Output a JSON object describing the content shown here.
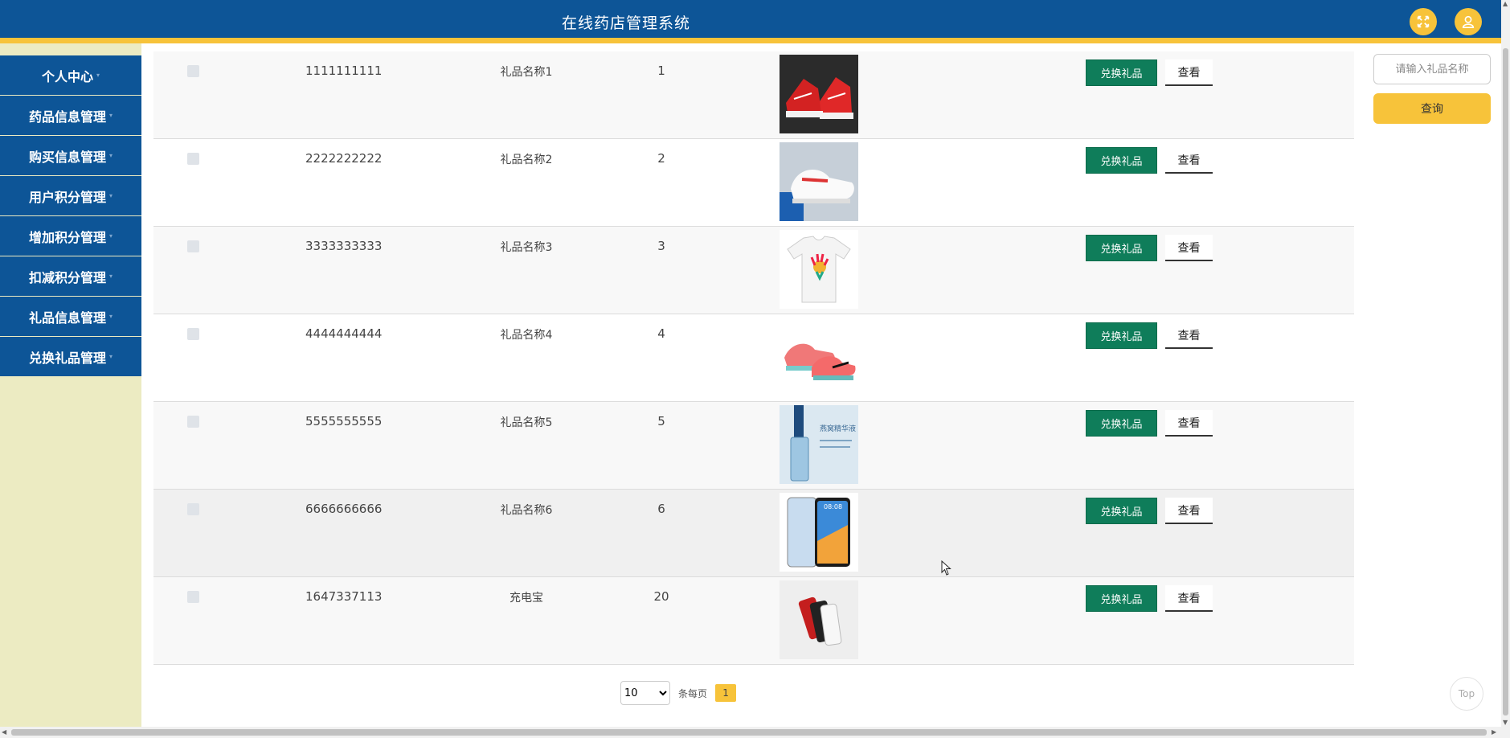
{
  "header": {
    "title": "在线药店管理系统",
    "fullscreen_icon": "expand-icon",
    "user_icon": "user-icon"
  },
  "sidebar": {
    "items": [
      {
        "label": "个人中心"
      },
      {
        "label": "药品信息管理"
      },
      {
        "label": "购买信息管理"
      },
      {
        "label": "用户积分管理"
      },
      {
        "label": "增加积分管理"
      },
      {
        "label": "扣减积分管理"
      },
      {
        "label": "礼品信息管理"
      },
      {
        "label": "兑换礼品管理"
      }
    ]
  },
  "table": {
    "rows": [
      {
        "id": "1111111111",
        "name": "礼品名称1",
        "num": "1",
        "image": "red-sneaker"
      },
      {
        "id": "2222222222",
        "name": "礼品名称2",
        "num": "2",
        "image": "white-sneaker"
      },
      {
        "id": "3333333333",
        "name": "礼品名称3",
        "num": "3",
        "image": "tshirt"
      },
      {
        "id": "4444444444",
        "name": "礼品名称4",
        "num": "4",
        "image": "pink-running-shoe"
      },
      {
        "id": "5555555555",
        "name": "礼品名称5",
        "num": "5",
        "image": "serum-bottle",
        "image_text": "燕窝精华液"
      },
      {
        "id": "6666666666",
        "name": "礼品名称6",
        "num": "6",
        "image": "smartphone",
        "image_text": "08:08"
      },
      {
        "id": "1647337113",
        "name": "充电宝",
        "num": "20",
        "image": "power-bank"
      }
    ],
    "exchange_label": "兑换礼品",
    "view_label": "查看"
  },
  "pager": {
    "page_size": "10",
    "per_label": "条每页",
    "current_page": "1"
  },
  "search": {
    "placeholder": "请输入礼品名称",
    "button_label": "查询"
  },
  "top_label": "Top",
  "colors": {
    "header": "#0d5597",
    "accent": "#f7c33a",
    "exchange": "#0f7d5a",
    "sidebar_bg": "#ecebc2"
  }
}
